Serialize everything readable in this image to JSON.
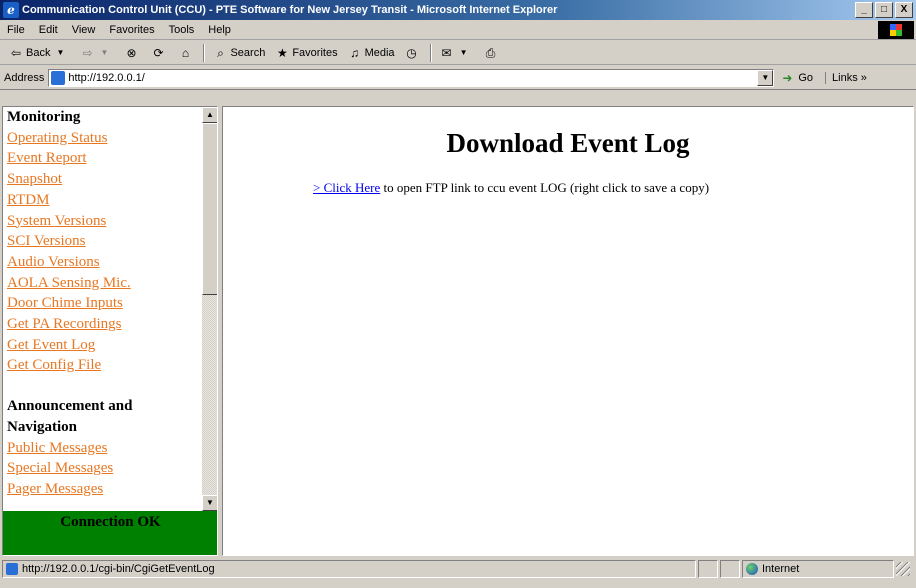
{
  "window": {
    "title": "Communication Control Unit (CCU) - PTE Software for New Jersey Transit - Microsoft Internet Explorer",
    "minimize": "_",
    "maximize": "□",
    "close": "X"
  },
  "menubar": [
    "File",
    "Edit",
    "View",
    "Favorites",
    "Tools",
    "Help"
  ],
  "toolbar": {
    "back": "Back",
    "search": "Search",
    "favorites": "Favorites",
    "media": "Media"
  },
  "addressbar": {
    "label": "Address",
    "url": "http://192.0.0.1/",
    "go": "Go",
    "links": "Links"
  },
  "sidebar": {
    "monitoring_header": "Monitoring",
    "monitoring_links": [
      "Operating Status",
      "Event Report",
      "Snapshot",
      "RTDM",
      "System Versions",
      "SCI Versions",
      "Audio Versions",
      "AOLA Sensing Mic.",
      "Door Chime Inputs",
      "Get PA Recordings",
      "Get Event Log",
      "Get Config File"
    ],
    "announcement_header_line1": "Announcement and",
    "announcement_header_line2": "Navigation",
    "announcement_links": [
      "Public Messages",
      "Special Messages",
      "Pager Messages"
    ],
    "connection_status": "Connection OK"
  },
  "main": {
    "heading": "Download Event Log",
    "link_text": "> Click Here",
    "description": " to open FTP link to ccu event LOG (right click to save a copy)"
  },
  "statusbar": {
    "url": "http://192.0.0.1/cgi-bin/CgiGetEventLog",
    "zone": "Internet"
  },
  "colors": {
    "nav_link": "#e87722",
    "connection_ok_bg": "#008000",
    "link": "#0000ee"
  }
}
